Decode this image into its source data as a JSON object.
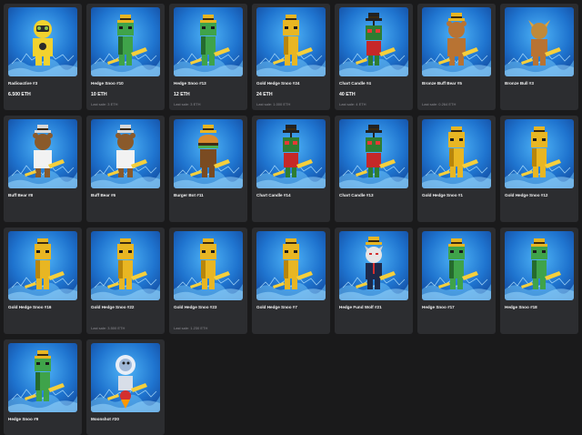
{
  "colors": {
    "background": "#1a1a1b",
    "card": "#2c2d30",
    "art_blue": "#1f74cf",
    "gold": "#e8b623",
    "green": "#3fa34a",
    "brown": "#8a5a2b"
  },
  "items": [
    {
      "name": "Radioactive #3",
      "price": "6.500 ETH",
      "last_sale": "",
      "character": "radioactive",
      "icon": "radioactive-character-icon"
    },
    {
      "name": "Hedge Snoo #10",
      "price": "10 ETH",
      "last_sale": "Last sale: 3 ETH",
      "character": "green-snoo",
      "icon": "green-snoo-icon"
    },
    {
      "name": "Hedge Snoo #13",
      "price": "12 ETH",
      "last_sale": "Last sale: 3 ETH",
      "character": "green-snoo",
      "icon": "green-snoo-icon"
    },
    {
      "name": "Gold Hedge Snoo #24",
      "price": "24 ETH",
      "last_sale": "Last sale: 1.000 ETH",
      "character": "gold-snoo",
      "icon": "gold-snoo-icon"
    },
    {
      "name": "Chart Candle #4",
      "price": "40 ETH",
      "last_sale": "Last sale: 4 ETH",
      "character": "chart-candle",
      "icon": "chart-candle-icon"
    },
    {
      "name": "Bronze Buff Bear #5",
      "price": "",
      "last_sale": "Last sale: 0.264 ETH",
      "character": "bronze-bear",
      "icon": "bronze-bear-icon"
    },
    {
      "name": "Bronze Bull #3",
      "price": "",
      "last_sale": "",
      "character": "bronze-bull",
      "icon": "bronze-bull-icon"
    },
    {
      "name": "Buff Bear #8",
      "price": "",
      "last_sale": "",
      "character": "buff-bear",
      "icon": "buff-bear-icon"
    },
    {
      "name": "Buff Bear #6",
      "price": "",
      "last_sale": "",
      "character": "buff-bear",
      "icon": "buff-bear-icon"
    },
    {
      "name": "Burger Bot #11",
      "price": "",
      "last_sale": "",
      "character": "burger-bot",
      "icon": "burger-bot-icon"
    },
    {
      "name": "Chart Candle #14",
      "price": "",
      "last_sale": "",
      "character": "chart-candle",
      "icon": "chart-candle-icon"
    },
    {
      "name": "Chart Candle #13",
      "price": "",
      "last_sale": "",
      "character": "chart-candle",
      "icon": "chart-candle-icon"
    },
    {
      "name": "Gold Hedge Snoo #1",
      "price": "",
      "last_sale": "",
      "character": "gold-snoo",
      "icon": "gold-snoo-icon"
    },
    {
      "name": "Gold Hedge Snoo #12",
      "price": "",
      "last_sale": "",
      "character": "gold-snoo",
      "icon": "gold-snoo-icon"
    },
    {
      "name": "Gold Hedge Snoo #16",
      "price": "",
      "last_sale": "",
      "character": "gold-snoo",
      "icon": "gold-snoo-icon"
    },
    {
      "name": "Gold Hedge Snoo #22",
      "price": "",
      "last_sale": "Last sale: 3.500 ETH",
      "character": "gold-snoo",
      "icon": "gold-snoo-icon"
    },
    {
      "name": "Gold Hedge Snoo #23",
      "price": "",
      "last_sale": "Last sale: 1.230 ETH",
      "character": "gold-snoo",
      "icon": "gold-snoo-icon"
    },
    {
      "name": "Gold Hedge Snoo #7",
      "price": "",
      "last_sale": "",
      "character": "gold-snoo",
      "icon": "gold-snoo-icon"
    },
    {
      "name": "Hedge Fund Wolf #21",
      "price": "",
      "last_sale": "",
      "character": "wolf",
      "icon": "hedge-fund-wolf-icon"
    },
    {
      "name": "Hedge Snoo #17",
      "price": "",
      "last_sale": "",
      "character": "green-snoo",
      "icon": "green-snoo-icon"
    },
    {
      "name": "Hedge Snoo #18",
      "price": "",
      "last_sale": "",
      "character": "green-snoo",
      "icon": "green-snoo-icon"
    },
    {
      "name": "Hedge Snoo #9",
      "price": "",
      "last_sale": "",
      "character": "green-snoo",
      "icon": "green-snoo-icon"
    },
    {
      "name": "Moonshot #20",
      "price": "",
      "last_sale": "",
      "character": "moonshot",
      "icon": "moonshot-character-icon"
    }
  ]
}
